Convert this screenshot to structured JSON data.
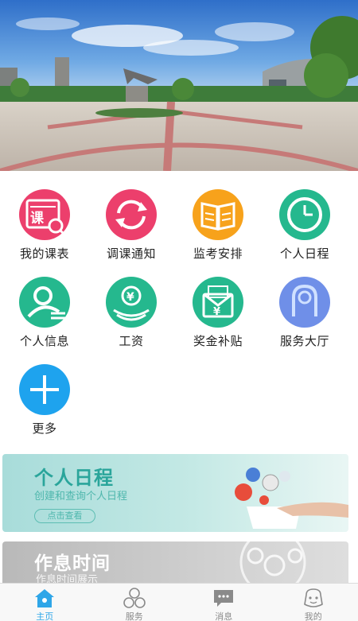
{
  "hero": {
    "image": "campus-plaza-photo"
  },
  "grid": {
    "items": [
      {
        "label": "我的课表",
        "icon": "timetable-icon",
        "color": "#ec3f6c"
      },
      {
        "label": "调课通知",
        "icon": "sync-icon",
        "color": "#ec3f6c"
      },
      {
        "label": "监考安排",
        "icon": "book-icon",
        "color": "#f7a21b"
      },
      {
        "label": "个人日程",
        "icon": "clock-icon",
        "color": "#25b88e"
      },
      {
        "label": "个人信息",
        "icon": "person-icon",
        "color": "#25b88e"
      },
      {
        "label": "工资",
        "icon": "salary-icon",
        "color": "#25b88e"
      },
      {
        "label": "奖金补贴",
        "icon": "bonus-envelope-icon",
        "color": "#25b88e"
      },
      {
        "label": "服务大厅",
        "icon": "service-hall-icon",
        "color": "#6f8fe8"
      },
      {
        "label": "更多",
        "icon": "plus-icon",
        "color": "#1ea3ee"
      }
    ]
  },
  "banners": {
    "schedule": {
      "title": "个人日程",
      "subtitle": "创建和查询个人日程",
      "button": "点击查看"
    },
    "rest": {
      "title": "作息时间",
      "subtitle": "作息时间展示"
    }
  },
  "tabbar": {
    "tabs": [
      {
        "label": "主页",
        "icon": "home-icon",
        "active": true
      },
      {
        "label": "服务",
        "icon": "services-icon",
        "active": false
      },
      {
        "label": "消息",
        "icon": "message-icon",
        "active": false
      },
      {
        "label": "我的",
        "icon": "profile-icon",
        "active": false
      }
    ],
    "active_color": "#2fa6e8",
    "inactive_color": "#8a8a8a"
  }
}
